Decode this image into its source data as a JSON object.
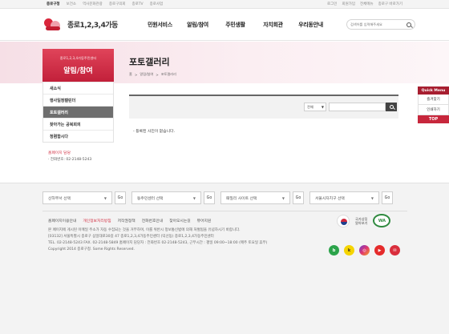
{
  "topbar": {
    "links": [
      "종로구청",
      "보건소",
      "역사문화관광",
      "종로구의회",
      "종로TV",
      "종로사업"
    ],
    "right": [
      "로그인",
      "회원가입",
      "전체메뉴",
      "종로구 바로가기"
    ]
  },
  "header": {
    "logo_text": "종로1,2,3,4가동",
    "gnb": [
      "민원서비스",
      "알림/참여",
      "주민생활",
      "자치회관",
      "우리동안내"
    ],
    "search_placeholder": "검색어를 입력해주세요"
  },
  "lnb": {
    "sub": "종로1,2,3,4가동주민센터",
    "title": "알림/참여",
    "items": [
      "새소식",
      "행사일정캘린더",
      "포토갤러리",
      "찾아가는 공북회의",
      "청렴합시다"
    ],
    "active_index": 2,
    "contact_title": "홈페이지 담당",
    "contact_phone": "· 전화번호: 02-2148-5243"
  },
  "page": {
    "title": "포토갤러리",
    "breadcrumb": [
      "홈",
      "알림/참여",
      "포토갤러리"
    ],
    "filter_select": "전체",
    "empty_message": "- 등록된 사진이 없습니다."
  },
  "quick": {
    "header": "Quick Menu",
    "items": [
      "즐겨찾기",
      "인쇄하기"
    ],
    "top": "TOP"
  },
  "footer": {
    "selects": [
      "산하부서 선택",
      "동주민센터 선택",
      "패밀리 사이트 선택",
      "서울시자치구 선택"
    ],
    "go_label": "Go",
    "links": [
      "홈페이지이용안내",
      "개인정보처리방침",
      "저작권정책",
      "전화번호안내",
      "찾아오시는길",
      "뷰어지원"
    ],
    "link_highlight_index": 1,
    "info": [
      "본 페이지에 게시된 이메일 주소가 자동 수집되는 것을 거부하며, 이를 위반시 정보통신법에 의해 처벌됨을 유념하시기 바랍니다.",
      "[03132] 서울특별시 종로구 삼일대로30길 47 종로1,2,3,4가동주민센터 (익선동) 종로1,2,3,4가동주민센터",
      "TEL. 02-2148-5243 FAX. 02-2148-5849 홈페이지 담당자 : 전화번호 02-2148-5243, 근무시간 : 평일 09:00~18:00 (매주 토요일 휴무)",
      "Copyright 2014 종로구청. Some Rights Reserved."
    ],
    "badge_text_1": "국가상징",
    "badge_text_2": "알아보기",
    "wa_text": "WA",
    "sns": [
      "b",
      "k",
      "◎",
      "▶",
      "✉"
    ]
  },
  "colors": {
    "brand": "#c2203a",
    "active_menu": "#6e6e6e"
  }
}
